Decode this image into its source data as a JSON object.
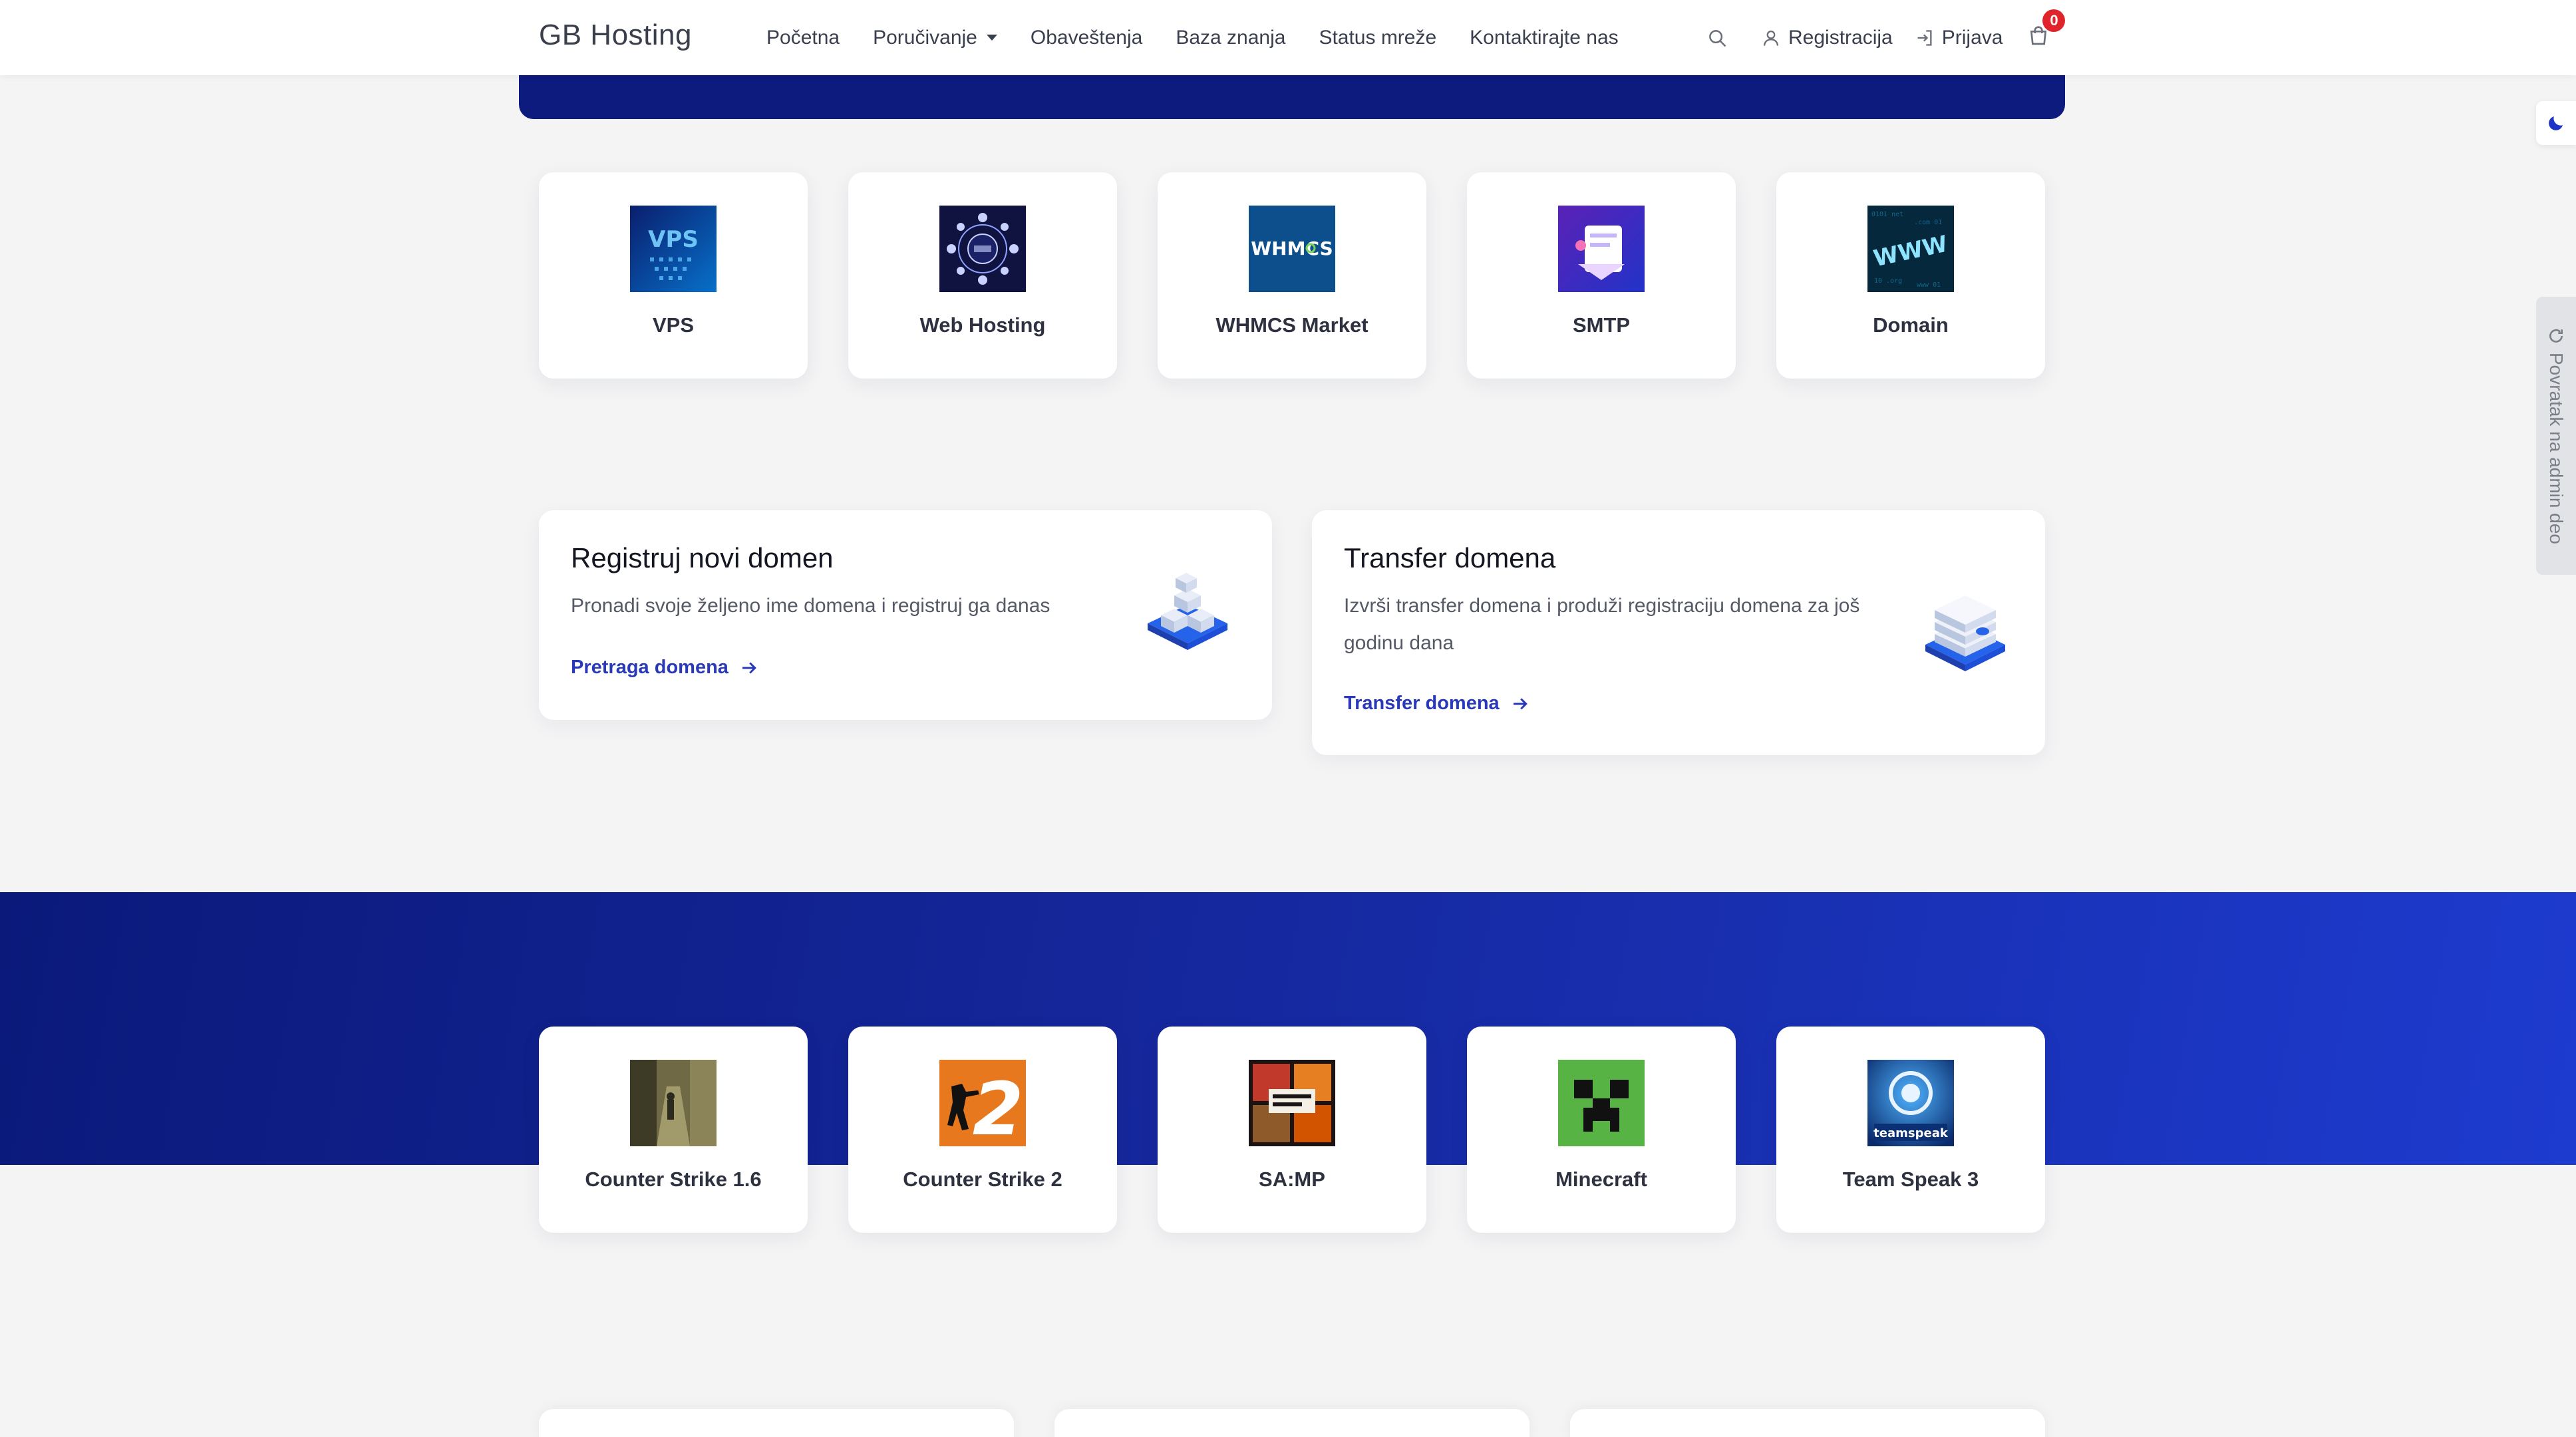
{
  "header": {
    "brand": "GB Hosting",
    "nav": [
      {
        "label": "Početna"
      },
      {
        "label": "Poručivanje",
        "has_dropdown": true
      },
      {
        "label": "Obaveštenja"
      },
      {
        "label": "Baza znanja"
      },
      {
        "label": "Status mreže"
      },
      {
        "label": "Kontaktirajte nas"
      }
    ],
    "register_label": "Registracija",
    "login_label": "Prijava",
    "cart_count": "0",
    "icons": {
      "search": "search-icon",
      "user": "user-icon",
      "login": "login-icon",
      "cart": "cart-icon"
    }
  },
  "side": {
    "admin_label": "Povratak na admin deo",
    "dark_mode_icon": "moon-icon",
    "admin_icon": "refresh-icon"
  },
  "products": [
    {
      "label": "VPS"
    },
    {
      "label": "Web Hosting"
    },
    {
      "label": "WHMCS Market",
      "thumb_text": "WHMCS"
    },
    {
      "label": "SMTP"
    },
    {
      "label": "Domain",
      "thumb_text": "WWW"
    }
  ],
  "domain_cards": [
    {
      "title": "Registruj novi domen",
      "text": "Pronadi svoje željeno ime domena i registruj ga danas",
      "link": "Pretraga domena"
    },
    {
      "title": "Transfer domena",
      "text_line1": "Izvrši transfer domena i produži registraciju domena za još",
      "text_line2": "godinu dana",
      "link": "Transfer domena"
    }
  ],
  "games": [
    {
      "label": "Counter Strike 1.6"
    },
    {
      "label": "Counter Strike 2",
      "thumb_text": "2"
    },
    {
      "label": "SA:MP"
    },
    {
      "label": "Minecraft"
    },
    {
      "label": "Team Speak 3",
      "thumb_text": "teamspeak"
    }
  ],
  "colors": {
    "primary": "#0d1a7e",
    "accent_link": "#2a39b9",
    "badge": "#e0242b",
    "band_start": "#0a197a",
    "band_end": "#1d3bcf"
  }
}
